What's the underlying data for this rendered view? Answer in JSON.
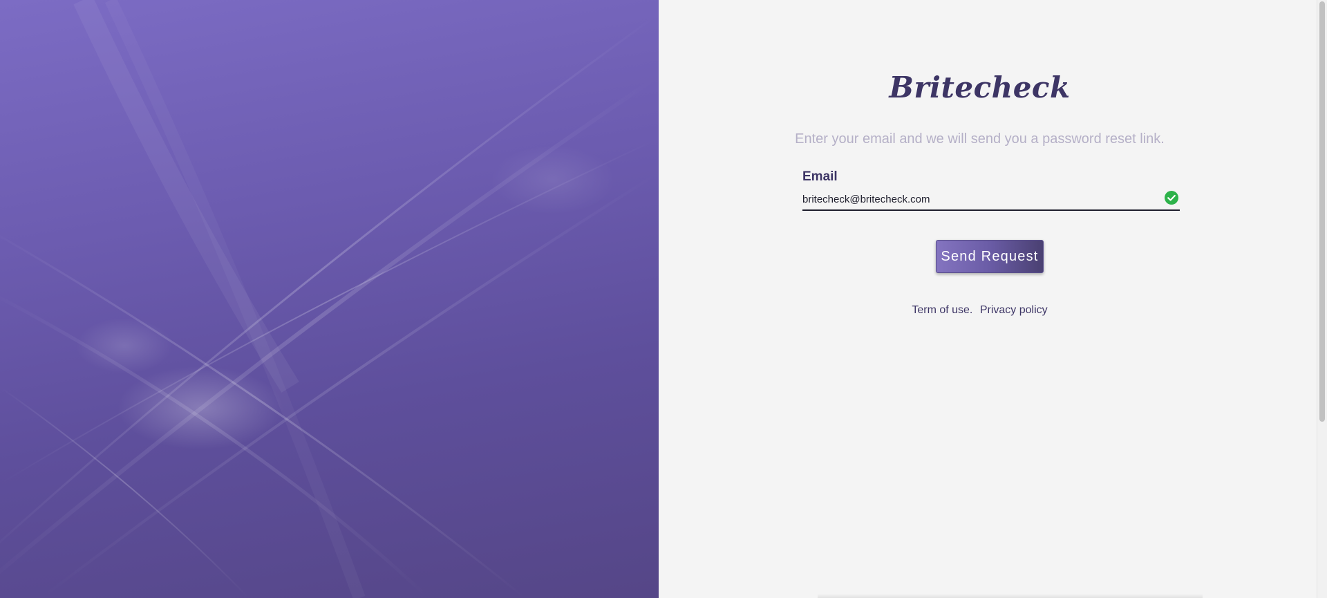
{
  "brand": {
    "name": "Britecheck",
    "color": "#3d3565"
  },
  "form": {
    "instructions": "Enter your email and we will send you a password reset link.",
    "email_label": "Email",
    "email_value": "britecheck@britecheck.com",
    "email_valid_icon": "check-circle-icon",
    "valid_color": "#2db24a",
    "submit_label": "Send Request"
  },
  "footer": {
    "terms_label": "Term of use.",
    "privacy_label": "Privacy policy"
  },
  "theme": {
    "hero_gradient_top": "#7c6cc4",
    "hero_gradient_bottom": "#554687",
    "panel_background": "#f4f4f4"
  }
}
